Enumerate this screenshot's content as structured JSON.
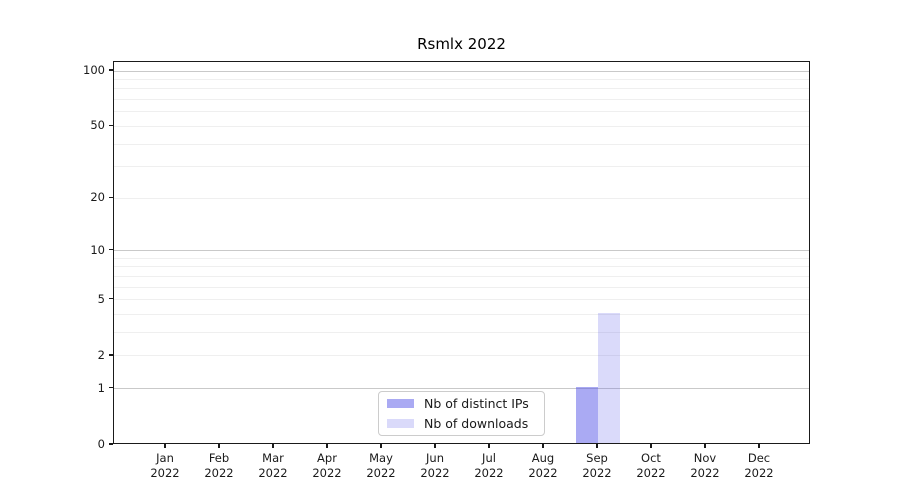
{
  "chart_data": {
    "type": "bar",
    "title": "Rsmlx 2022",
    "categories": [
      "Jan 2022",
      "Feb 2022",
      "Mar 2022",
      "Apr 2022",
      "May 2022",
      "Jun 2022",
      "Jul 2022",
      "Aug 2022",
      "Sep 2022",
      "Oct 2022",
      "Nov 2022",
      "Dec 2022"
    ],
    "series": [
      {
        "name": "Nb of distinct IPs",
        "values": [
          0,
          0,
          0,
          0,
          0,
          0,
          0,
          0,
          1,
          0,
          0,
          0
        ],
        "color": "rgba(85,85,232,0.5)"
      },
      {
        "name": "Nb of downloads",
        "values": [
          0,
          0,
          0,
          0,
          0,
          0,
          0,
          0,
          4,
          0,
          0,
          0
        ],
        "color": "rgba(85,85,232,0.22)"
      }
    ],
    "xlabel": "",
    "ylabel": "",
    "y_scale": "log10(1+value)",
    "ylim": [
      0,
      112
    ],
    "y_ticks": [
      0,
      1,
      2,
      5,
      10,
      20,
      50,
      100
    ],
    "grid": {
      "major_values": [
        1,
        10,
        100
      ],
      "minor_values": [
        2,
        3,
        4,
        5,
        6,
        7,
        8,
        9,
        20,
        30,
        40,
        50,
        60,
        70,
        80,
        90
      ],
      "major_color": "#c9c9c9",
      "minor_color": "#efefef"
    },
    "legend_position": "lower center",
    "colors": {
      "axis": "#1a1a1a",
      "background": "#ffffff"
    }
  }
}
